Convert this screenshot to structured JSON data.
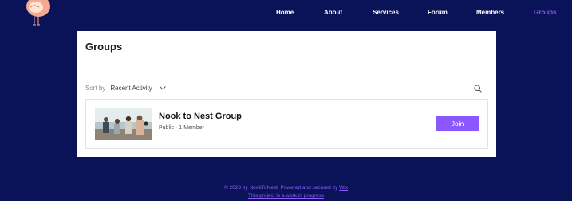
{
  "header": {
    "nav": [
      "Home",
      "About",
      "Services",
      "Forum",
      "Members",
      "Groups"
    ],
    "active_nav": "Groups"
  },
  "panel": {
    "title": "Groups",
    "sort_label": "Sort by",
    "sort_value": "Recent Activity"
  },
  "group": {
    "name": "Nook to Nest Group",
    "privacy": "Public",
    "separator": "·",
    "members": "1 Member",
    "join_label": "Join"
  },
  "footer": {
    "text": "© 2023 by NookToNest. Powered and secured by",
    "link": "Wix",
    "note": "This project is a work in progress"
  },
  "colors": {
    "background": "#0b1358",
    "accent": "#8b58ff",
    "card": "#ffffff"
  },
  "icons": [
    "bird-logo-icon",
    "chevron-down-icon",
    "search-icon"
  ]
}
